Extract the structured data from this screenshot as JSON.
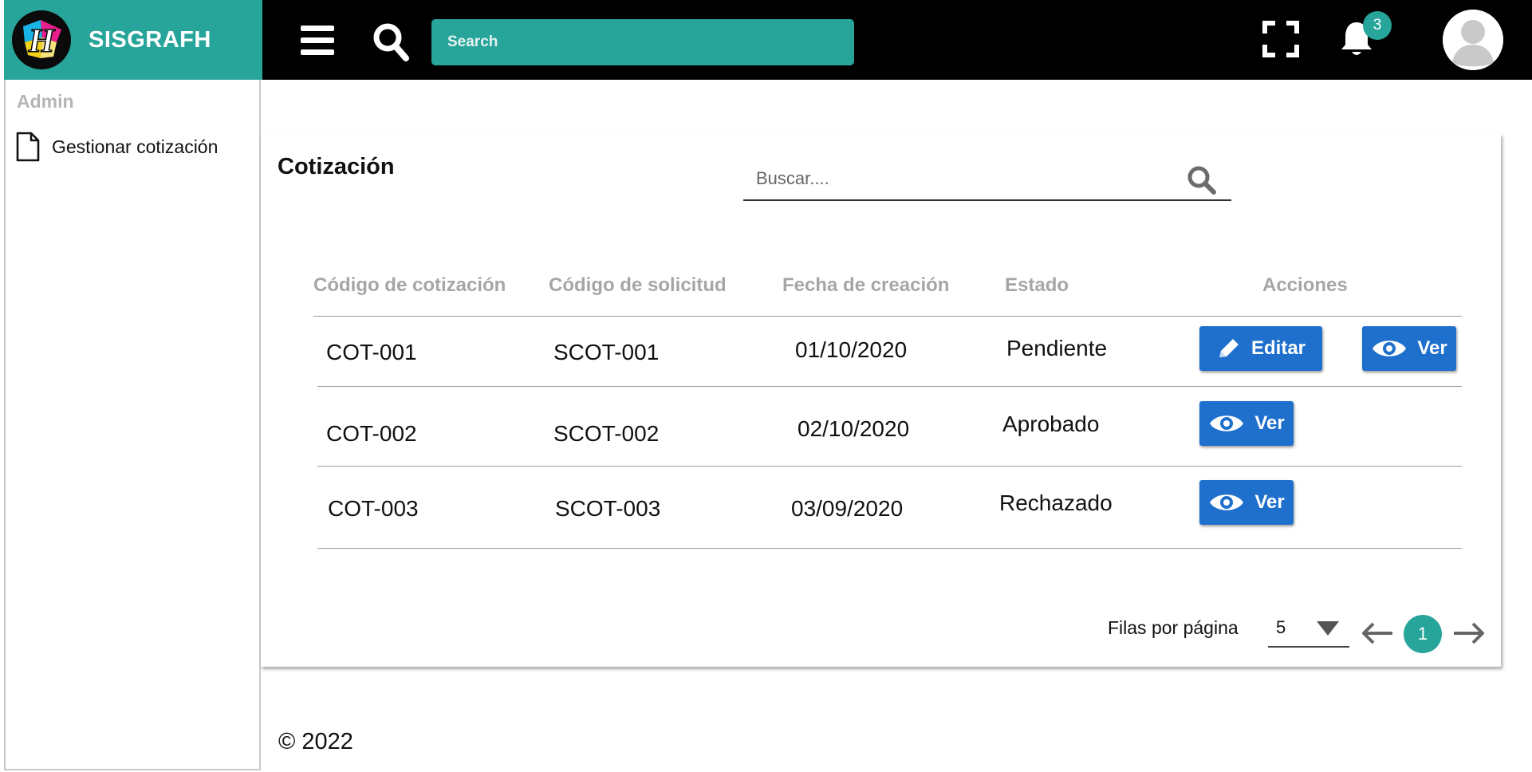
{
  "brand": {
    "name": "SISGRAFH",
    "logo_letter": "H"
  },
  "topbar": {
    "search_placeholder": "Search",
    "notification_count": "3",
    "icons": [
      "menu-icon",
      "search-icon",
      "fullscreen-icon",
      "bell-icon",
      "user-avatar-icon"
    ]
  },
  "sidebar": {
    "heading": "Admin",
    "items": [
      {
        "label": "Gestionar cotización",
        "icon": "document-icon"
      }
    ]
  },
  "main": {
    "title": "Cotización",
    "search_placeholder": "Buscar....",
    "table": {
      "headers": [
        "Código de cotización",
        "Código de solicitud",
        "Fecha de creación",
        "Estado",
        "Acciones"
      ],
      "rows": [
        {
          "cot": "COT-001",
          "sol": "SCOT-001",
          "fecha": "01/10/2020",
          "estado": "Pendiente",
          "actions": [
            "Editar",
            "Ver"
          ]
        },
        {
          "cot": "COT-002",
          "sol": "SCOT-002",
          "fecha": "02/10/2020",
          "estado": "Aprobado",
          "actions": [
            "Ver"
          ]
        },
        {
          "cot": "COT-003",
          "sol": "SCOT-003",
          "fecha": "03/09/2020",
          "estado": "Rechazado",
          "actions": [
            "Ver"
          ]
        }
      ]
    },
    "pagination": {
      "rows_label": "Filas por página",
      "rows_value": "5",
      "current_page": "1"
    }
  },
  "footer": {
    "text": "© 2022"
  },
  "colors": {
    "teal": "#27a59a",
    "blue_button": "#1f6fcc",
    "topbar": "#000000"
  }
}
